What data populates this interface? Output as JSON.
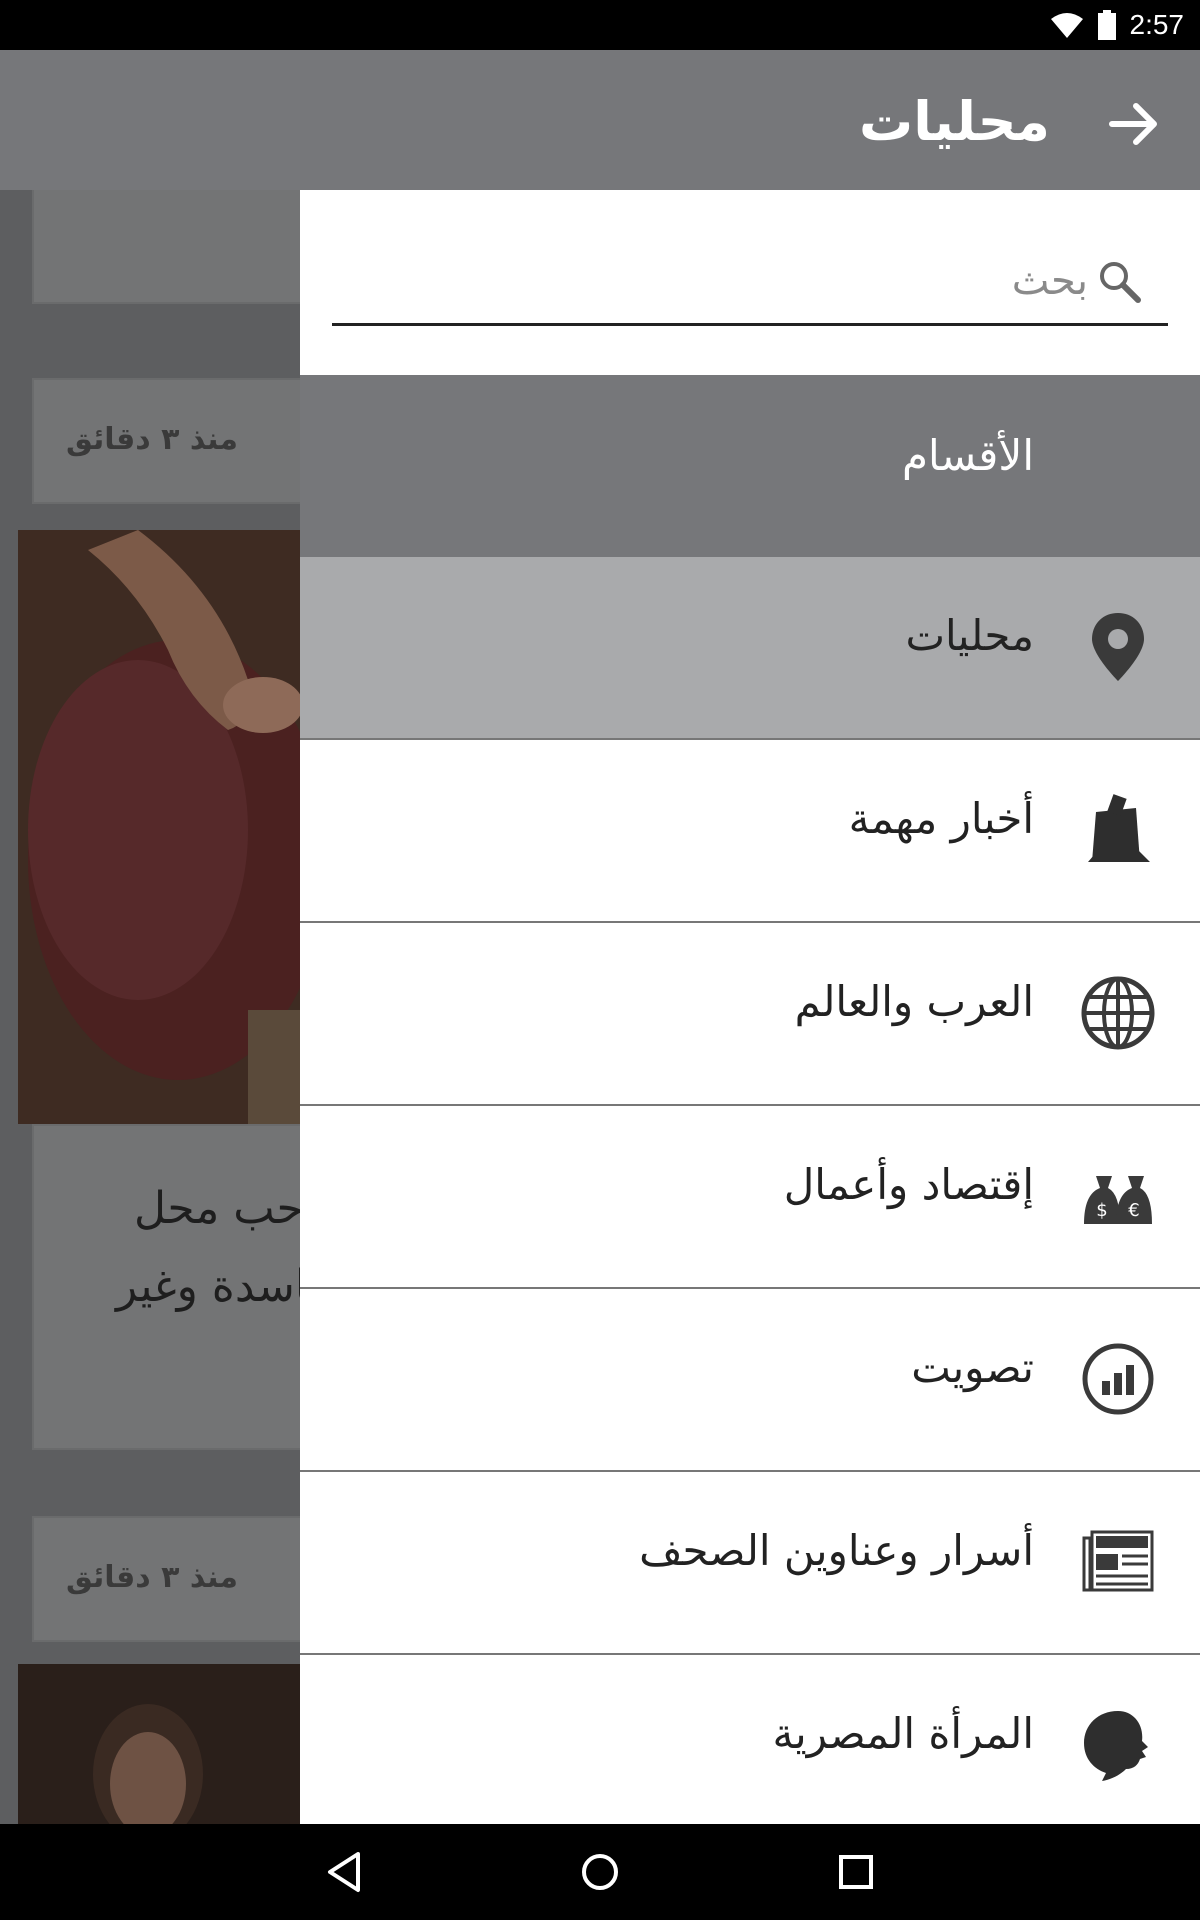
{
  "status_bar": {
    "time": "2:57"
  },
  "toolbar": {
    "title": "محليات"
  },
  "background": {
    "cards": [
      {
        "time": "منذ ٣ دقائق",
        "text_line1": "صاحب محل",
        "text_line2": "فاسدة وغير"
      },
      {
        "time": "منذ ٣ دقائق"
      }
    ]
  },
  "drawer": {
    "search": {
      "placeholder": "بحث",
      "value": ""
    },
    "section_header": "الأقسام",
    "items": [
      {
        "label": "محليات",
        "icon": "location-pin-icon",
        "active": true
      },
      {
        "label": "أخبار مهمة",
        "icon": "breaking-news-icon",
        "active": false
      },
      {
        "label": "العرب والعالم",
        "icon": "globe-icon",
        "active": false
      },
      {
        "label": "إقتصاد وأعمال",
        "icon": "money-bags-icon",
        "active": false
      },
      {
        "label": "تصويت",
        "icon": "poll-chart-icon",
        "active": false
      },
      {
        "label": "أسرار وعناوين الصحف",
        "icon": "newspaper-icon",
        "active": false
      },
      {
        "label": "المرأة المصرية",
        "icon": "woman-head-icon",
        "active": false
      }
    ]
  },
  "colors": {
    "toolbar": "#76777a",
    "active_item": "#a9aaac",
    "icon": "#3a3a3a"
  }
}
